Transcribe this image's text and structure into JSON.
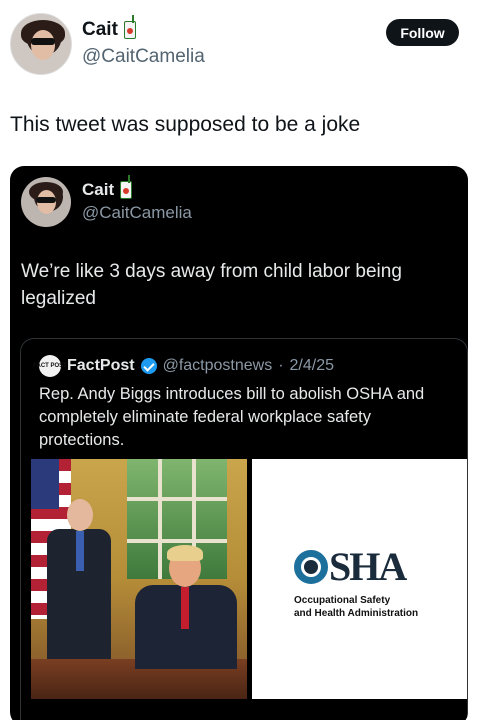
{
  "author": {
    "name": "Cait",
    "handle": "@CaitCamelia",
    "follow_label": "Follow"
  },
  "tweet": {
    "text": "This tweet was supposed to be a joke"
  },
  "quoted": {
    "name": "Cait",
    "handle": "@CaitCamelia",
    "text": "We’re like 3 days away from child labor being legalized",
    "inner": {
      "logo_text": "FACT POST",
      "name": "FactPost",
      "handle": "@factpostnews",
      "separator": "·",
      "date": "2/4/25",
      "text": "Rep. Andy Biggs introduces bill to abolish OSHA and completely eliminate federal workplace safety protections.",
      "osha": {
        "word": "SHA",
        "subtitle_line1": "Occupational Safety",
        "subtitle_line2": "and Health Administration"
      }
    }
  },
  "icons": {
    "juice": "juice-box-icon",
    "verified": "verified-check-icon"
  },
  "colors": {
    "follow_bg": "#0f1419",
    "verified": "#1d9bf0",
    "osha_blue": "#1d6f9c"
  }
}
